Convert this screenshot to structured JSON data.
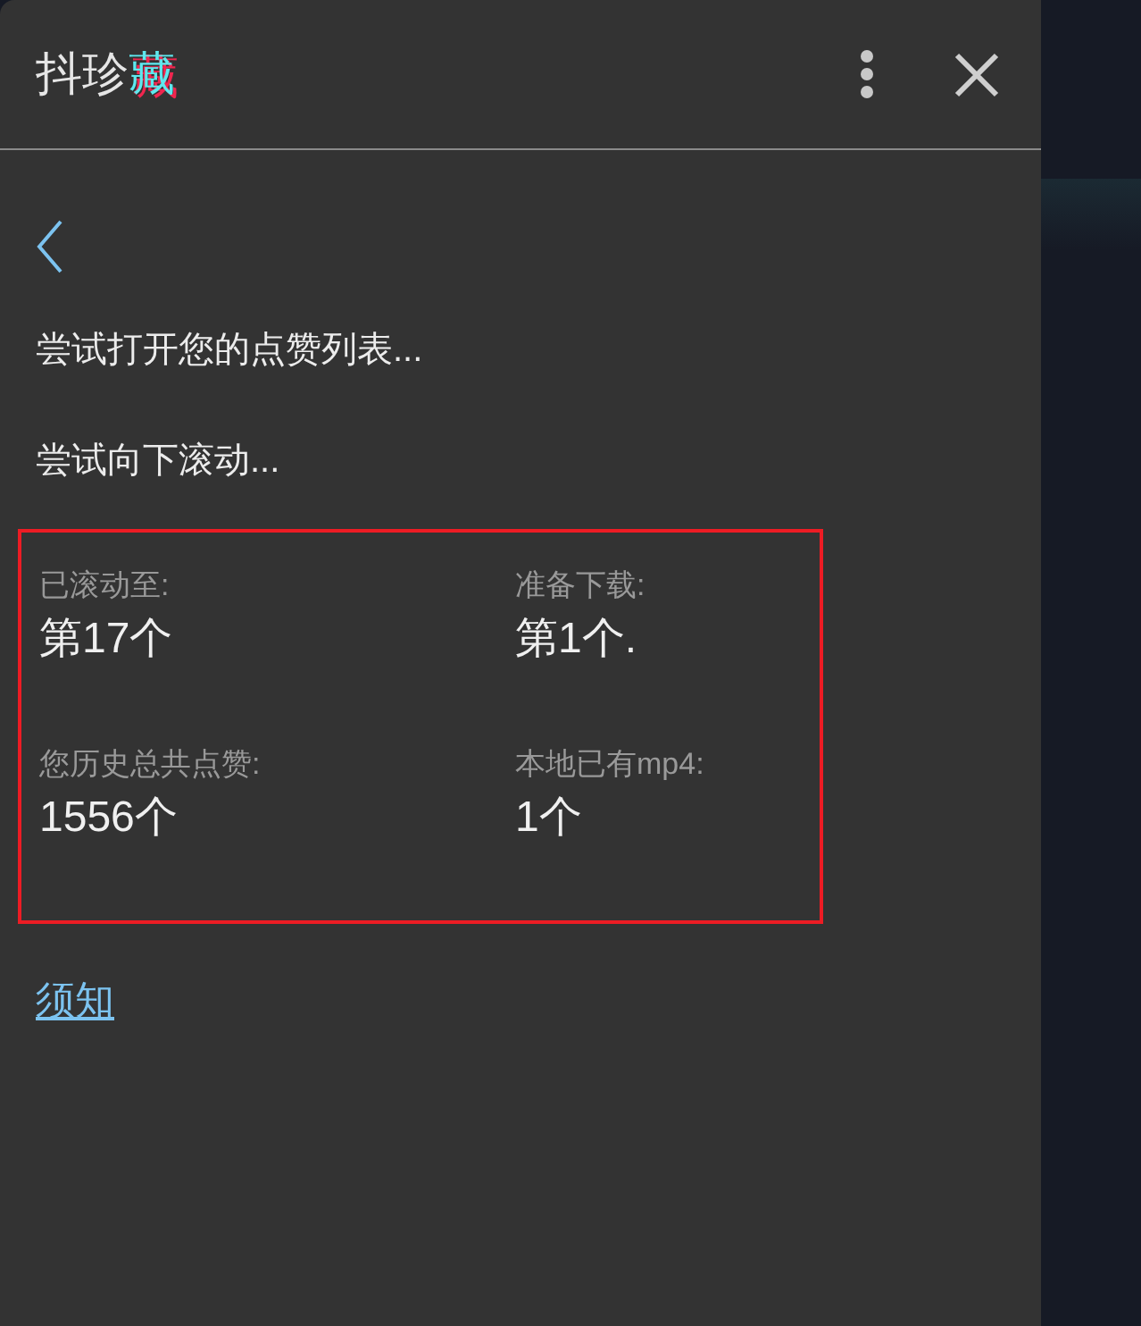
{
  "header": {
    "title": "抖珍藏"
  },
  "status_lines": [
    "尝试打开您的点赞列表...",
    "尝试向下滚动..."
  ],
  "stats": [
    {
      "label": "已滚动至:",
      "value": "第17个"
    },
    {
      "label": "准备下载:",
      "value": "第1个."
    },
    {
      "label": "您历史总共点赞:",
      "value": "1556个"
    },
    {
      "label": "本地已有mp4:",
      "value": "1个"
    }
  ],
  "link": "须知"
}
